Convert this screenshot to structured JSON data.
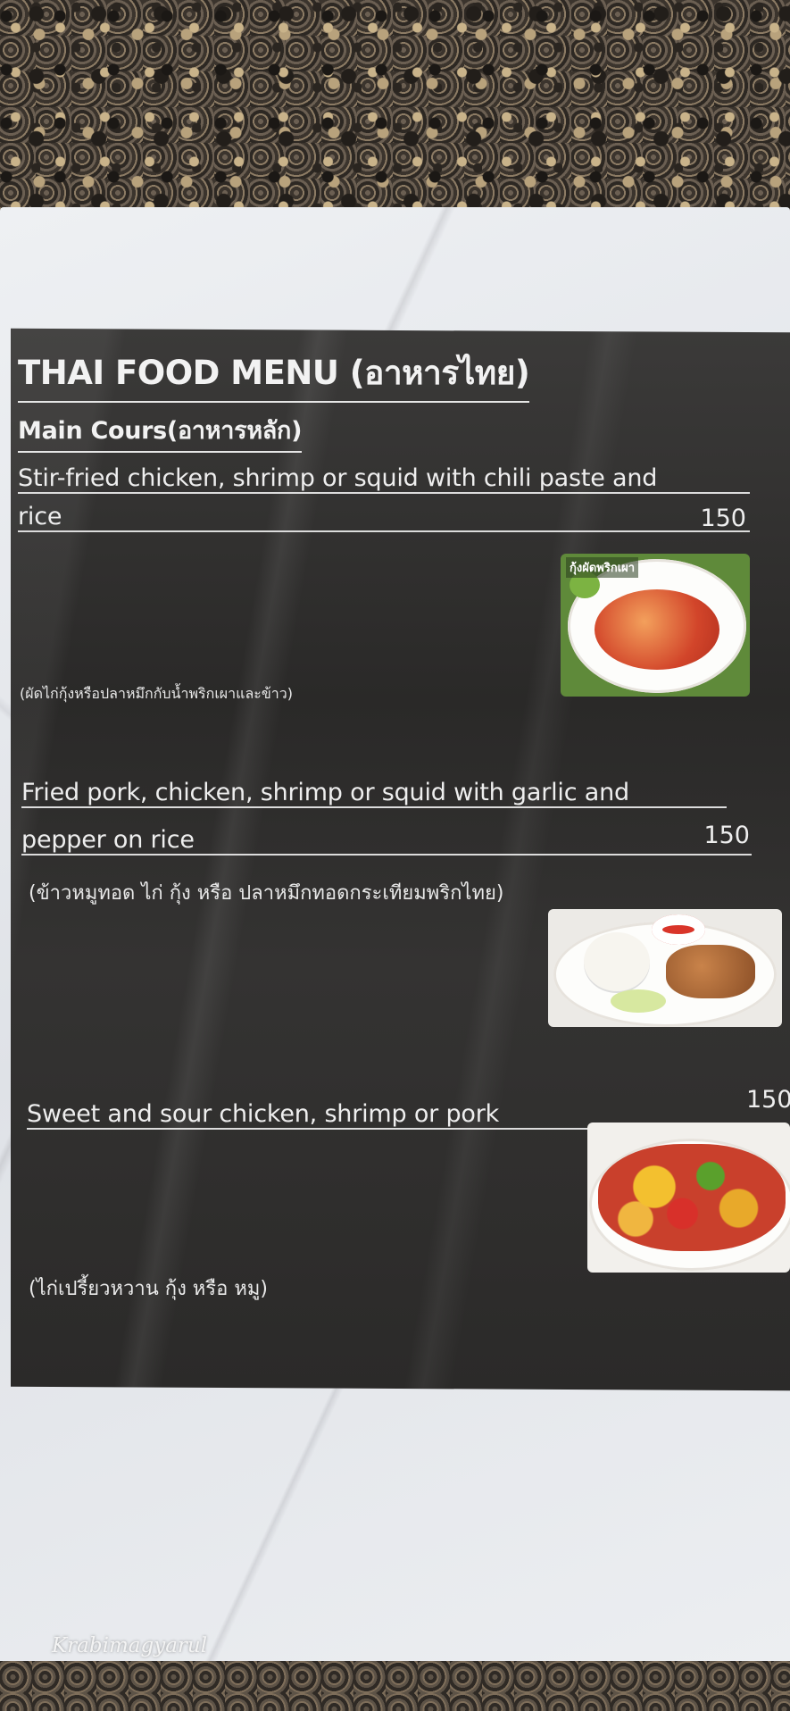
{
  "menu": {
    "title": "THAI FOOD MENU (อาหารไทย)",
    "section": "Main Cours(อาหารหลัก)",
    "items": [
      {
        "name_line1": "Stir-fried chicken, shrimp or squid with chili paste and",
        "name_line2": "rice",
        "price": "150",
        "thai": "(ผัดไก่กุ้งหรือปลาหมึกกับน้ำพริกเผาและข้าว)",
        "photo_label": "กุ้งผัดพริกเผา"
      },
      {
        "name_line1": "Fried pork, chicken, shrimp or squid with garlic and",
        "name_line2": "pepper on rice",
        "price": "150",
        "thai": "(ข้าวหมูทอด ไก่ กุ้ง หรือ ปลาหมึกทอดกระเทียมพริกไทย)"
      },
      {
        "name_line1": "Sweet and sour chicken, shrimp or pork",
        "price": "150",
        "thai": "(ไก่เปรี้ยวหวาน กุ้ง หรือ หมู)"
      }
    ]
  },
  "watermark": "Krabimagyarul"
}
